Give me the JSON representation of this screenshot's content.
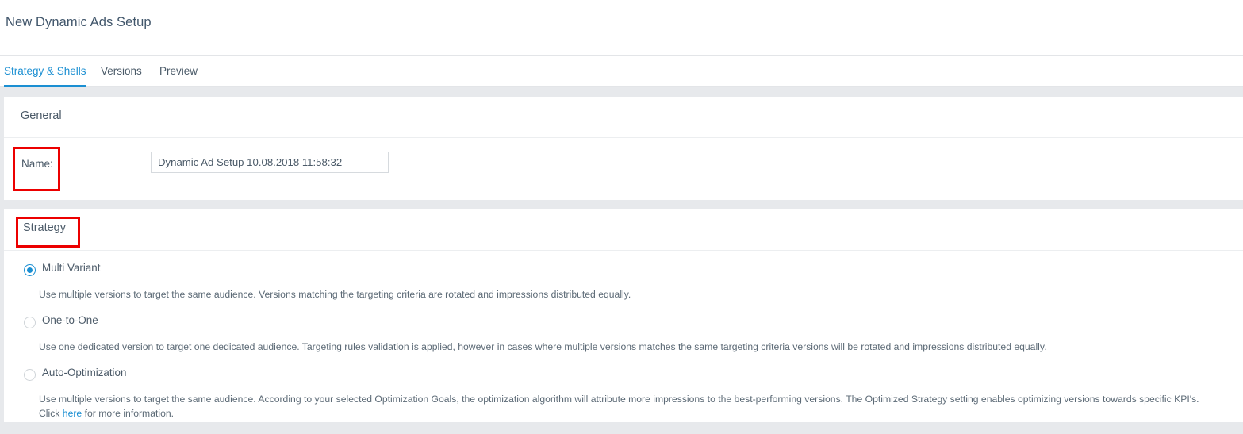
{
  "header": {
    "title": "New Dynamic Ads Setup"
  },
  "tabs": [
    {
      "label": "Strategy & Shells",
      "active": true
    },
    {
      "label": "Versions",
      "active": false
    },
    {
      "label": "Preview",
      "active": false
    }
  ],
  "general": {
    "section_title": "General",
    "name_label": "Name:",
    "name_value": "Dynamic Ad Setup 10.08.2018 11:58:32",
    "name_placeholder": ""
  },
  "strategy": {
    "section_title": "Strategy",
    "options": [
      {
        "label": "Multi Variant",
        "selected": true,
        "description": "Use multiple versions to target the same audience. Versions matching the targeting criteria are rotated and impressions distributed equally."
      },
      {
        "label": "One-to-One",
        "selected": false,
        "description": "Use one dedicated version to target one dedicated audience. Targeting rules validation is applied, however in cases where multiple versions matches the same targeting criteria versions will be rotated and impressions distributed equally."
      },
      {
        "label": "Auto-Optimization",
        "selected": false,
        "description_before_link": "Use multiple versions to target the same audience. According to your selected Optimization Goals, the optimization algorithm will attribute more impressions to the best-performing versions. The Optimized Strategy setting enables optimizing versions towards specific KPI's. Click ",
        "link_text": "here",
        "description_after_link": " for more information."
      }
    ]
  },
  "annotations": {
    "highlight_color": "#ec0000",
    "boxes": [
      {
        "target": "name-label"
      },
      {
        "target": "strategy-section-title"
      }
    ]
  },
  "colors": {
    "accent": "#1b8fd2",
    "text": "#4b5a68",
    "page_background": "#e7e9ec",
    "panel_background": "#ffffff",
    "highlight": "#ec0000"
  }
}
